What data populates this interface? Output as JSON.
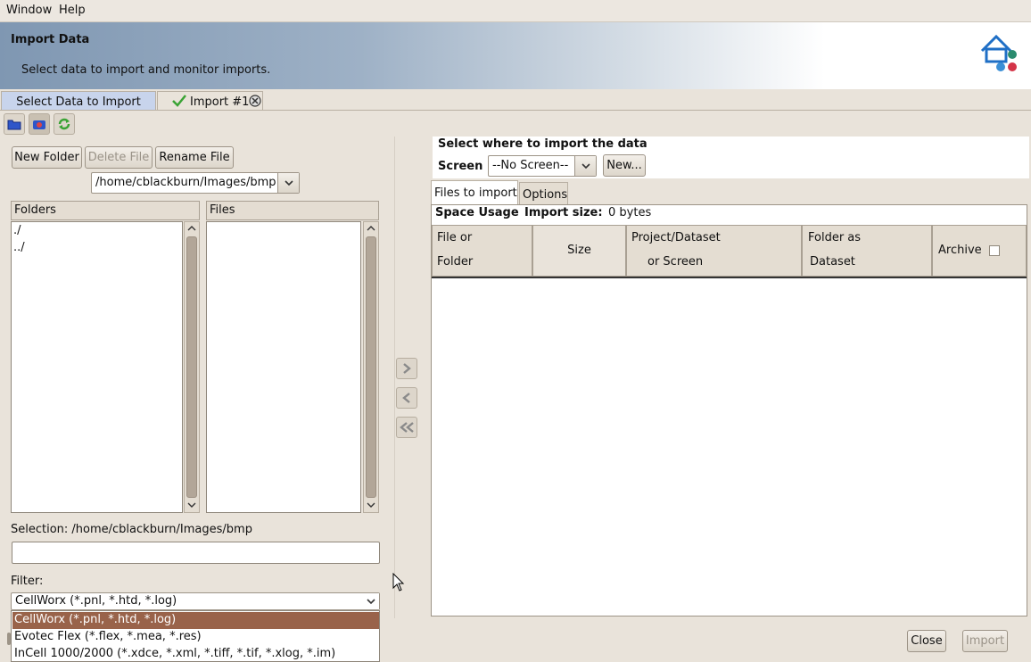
{
  "menu": {
    "window": "Window",
    "help": "Help"
  },
  "banner": {
    "title": "Import Data",
    "subtitle": "Select data to import and monitor imports."
  },
  "tabs": {
    "select": "Select Data to Import",
    "import": "Import #1"
  },
  "buttons": {
    "new_folder": "New Folder",
    "delete_file": "Delete File",
    "rename_file": "Rename File",
    "new": "New...",
    "close": "Close",
    "import": "Import"
  },
  "path_combo": "/home/cblackburn/Images/bmp",
  "panels": {
    "folders": "Folders",
    "files": "Files"
  },
  "folders": [
    "./",
    "../"
  ],
  "selection": {
    "label": "Selection: /home/cblackburn/Images/bmp",
    "value": ""
  },
  "filter": {
    "label": "Filter:",
    "value": "CellWorx (*.pnl, *.htd, *.log)",
    "options": [
      "CellWorx (*.pnl, *.htd, *.log)",
      "Evotec Flex (*.flex, *.mea, *.res)",
      "InCell 1000/2000 (*.xdce, *.xml, *.tiff, *.tif, *.xlog, *.im)"
    ]
  },
  "right": {
    "heading": "Select where to import the data",
    "screen_label": "Screen",
    "screen_value": "--No Screen--",
    "tab_files": "Files to import",
    "tab_options": "Options",
    "space_label": "Space Usage",
    "import_size_label": "Import size:",
    "import_size_value": "0 bytes",
    "col_file_1": "File or",
    "col_file_2": "Folder",
    "col_size": "Size",
    "col_project_1": "Project/Dataset",
    "col_project_2": "or Screen",
    "col_folder_1": "Folder as",
    "col_folder_2": "Dataset",
    "col_archive": "Archive"
  },
  "colors": {
    "tab_active": "#c8d4ec",
    "dropdown_selected": "#99634a",
    "banner_start": "#7f97b2"
  }
}
